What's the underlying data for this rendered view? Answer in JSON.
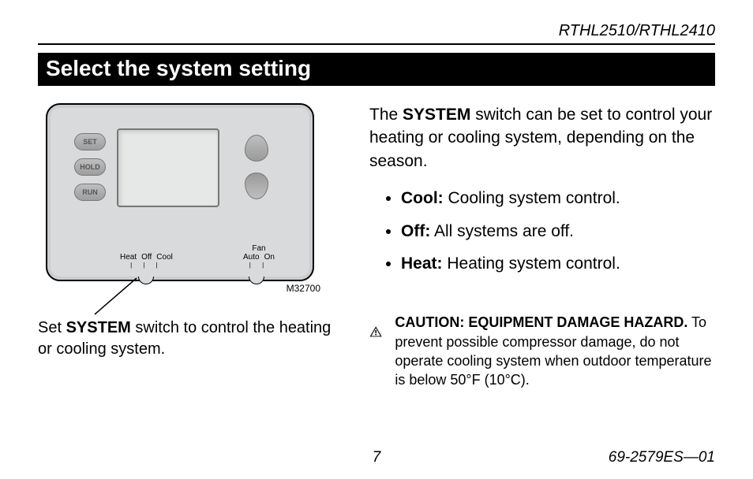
{
  "header": {
    "model": "RTHL2510/RTHL2410"
  },
  "title": "Select the system setting",
  "diagram": {
    "buttons": {
      "set": "SET",
      "hold": "HOLD",
      "run": "RUN"
    },
    "system_switch": {
      "heat": "Heat",
      "off": "Off",
      "cool": "Cool"
    },
    "fan_switch": {
      "title": "Fan",
      "auto": "Auto",
      "on": "On"
    },
    "id": "M32700"
  },
  "caption": {
    "prefix": "Set ",
    "bold": "SYSTEM",
    "suffix": " switch to control the heating or cooling system."
  },
  "intro": {
    "prefix": "The ",
    "bold": "SYSTEM",
    "suffix": " switch can be set to control your heating or cooling system, depend­ing on the season."
  },
  "options": [
    {
      "label": "Cool:",
      "desc": " Cooling system control."
    },
    {
      "label": "Off:",
      "desc": "  All systems are off."
    },
    {
      "label": "Heat:",
      "desc": " Heating system control."
    }
  ],
  "caution": {
    "title": "CAUTION: EQUIPMENT DAMAGE HAZARD.",
    "body": " To prevent possible compressor damage, do not operate cooling system when outdoor temperature is below 50°F (10°C)."
  },
  "footer": {
    "page": "7",
    "doc_id": "69-2579ES—01"
  }
}
